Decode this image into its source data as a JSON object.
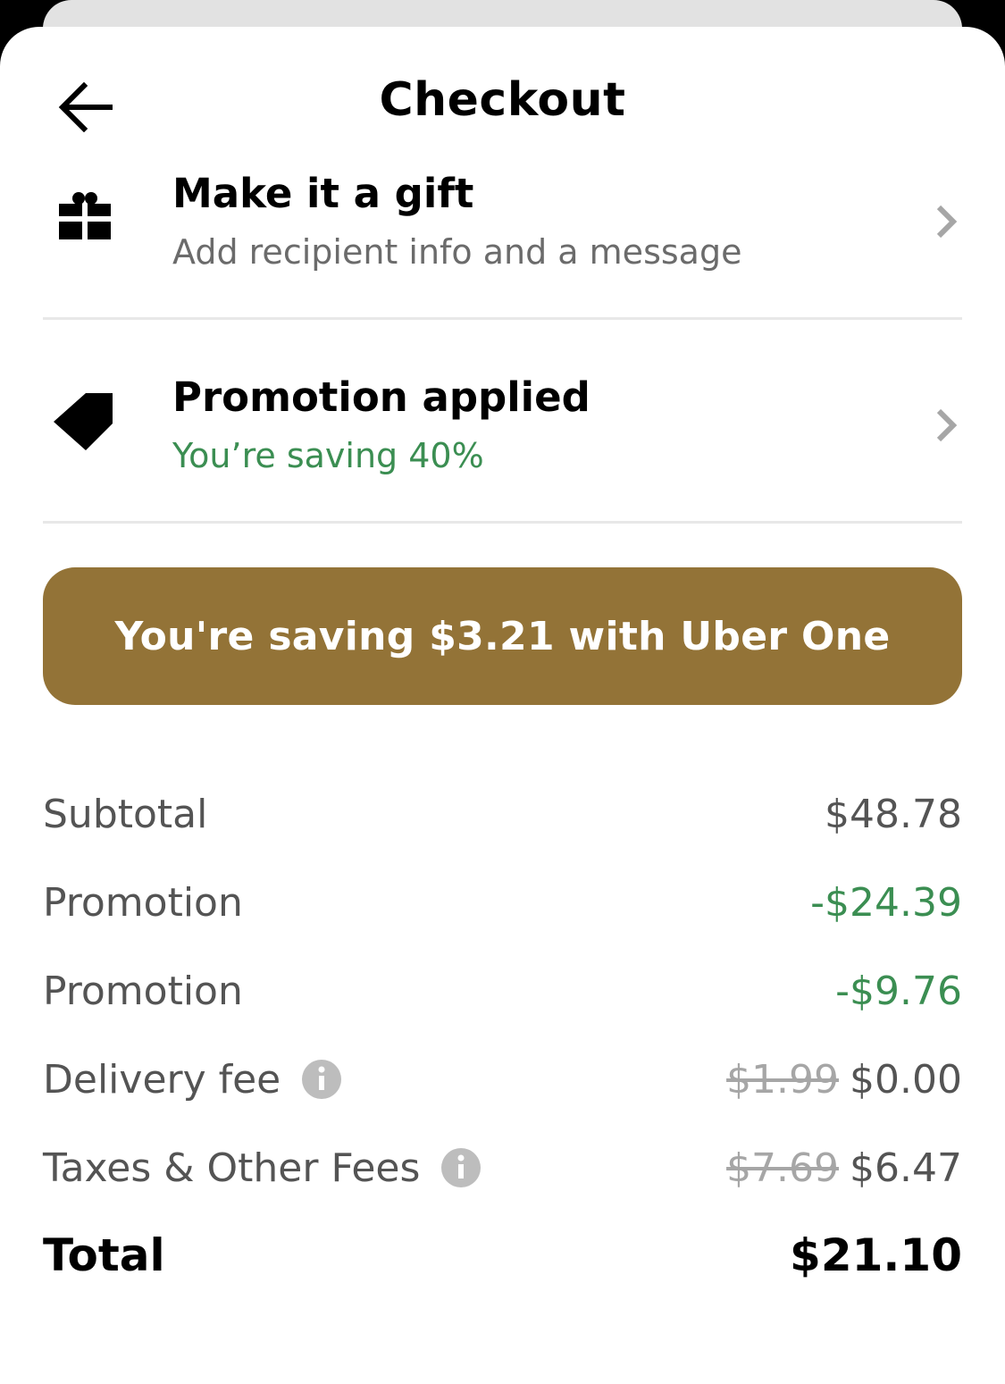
{
  "header": {
    "title": "Checkout"
  },
  "gift": {
    "title": "Make it a gift",
    "subtitle": "Add recipient info and a message"
  },
  "promotion": {
    "title": "Promotion applied",
    "subtitle": "You’re saving 40%"
  },
  "uber_one": {
    "label": "You're saving $3.21 with Uber One"
  },
  "summary": {
    "subtotal_label": "Subtotal",
    "subtotal_value": "$48.78",
    "promo1_label": "Promotion",
    "promo1_value": "-$24.39",
    "promo2_label": "Promotion",
    "promo2_value": "-$9.76",
    "delivery_label": "Delivery fee",
    "delivery_original": "$1.99",
    "delivery_value": "$0.00",
    "taxes_label": "Taxes & Other Fees",
    "taxes_original": "$7.69",
    "taxes_value": "$6.47",
    "total_label": "Total",
    "total_value": "$21.10"
  },
  "colors": {
    "uber_one_gold": "#937337",
    "savings_green": "#3b8e52",
    "muted_text": "#545454"
  },
  "icons": {
    "back": "arrow-left-icon",
    "gift": "gift-icon",
    "promo": "tag-icon",
    "chevron": "chevron-right-icon",
    "info": "info-icon"
  }
}
